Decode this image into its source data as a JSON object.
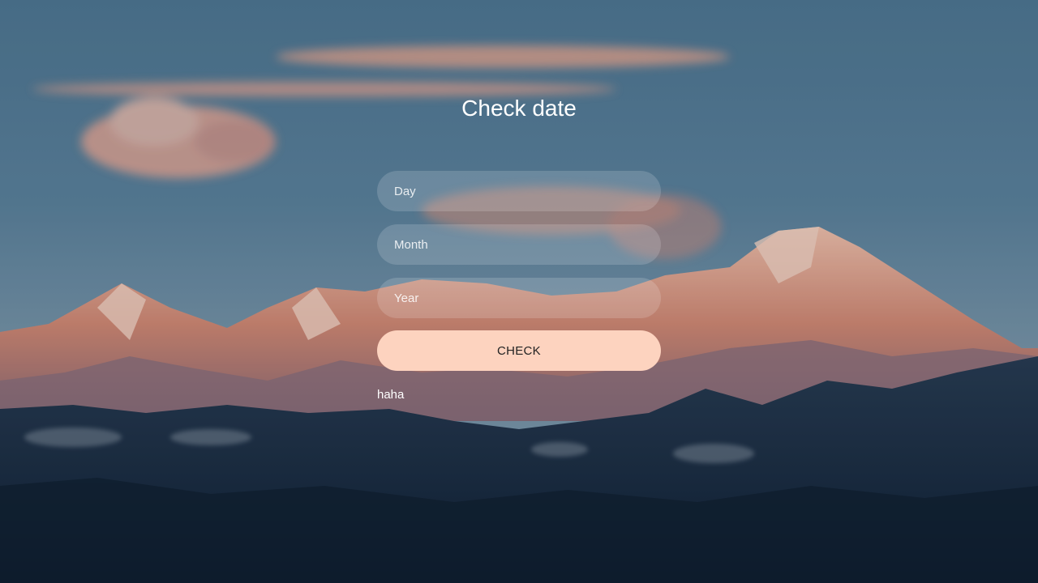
{
  "page": {
    "title": "Check date"
  },
  "form": {
    "day_placeholder": "Day",
    "month_placeholder": "Month",
    "year_placeholder": "Year",
    "day_value": "",
    "month_value": "",
    "year_value": "",
    "check_label": "CHECK",
    "result_text": "haha"
  },
  "theme": {
    "button_color": "#fdd3bf",
    "field_background": "rgba(255,255,255,0.16)",
    "text_color": "#ffffff"
  }
}
